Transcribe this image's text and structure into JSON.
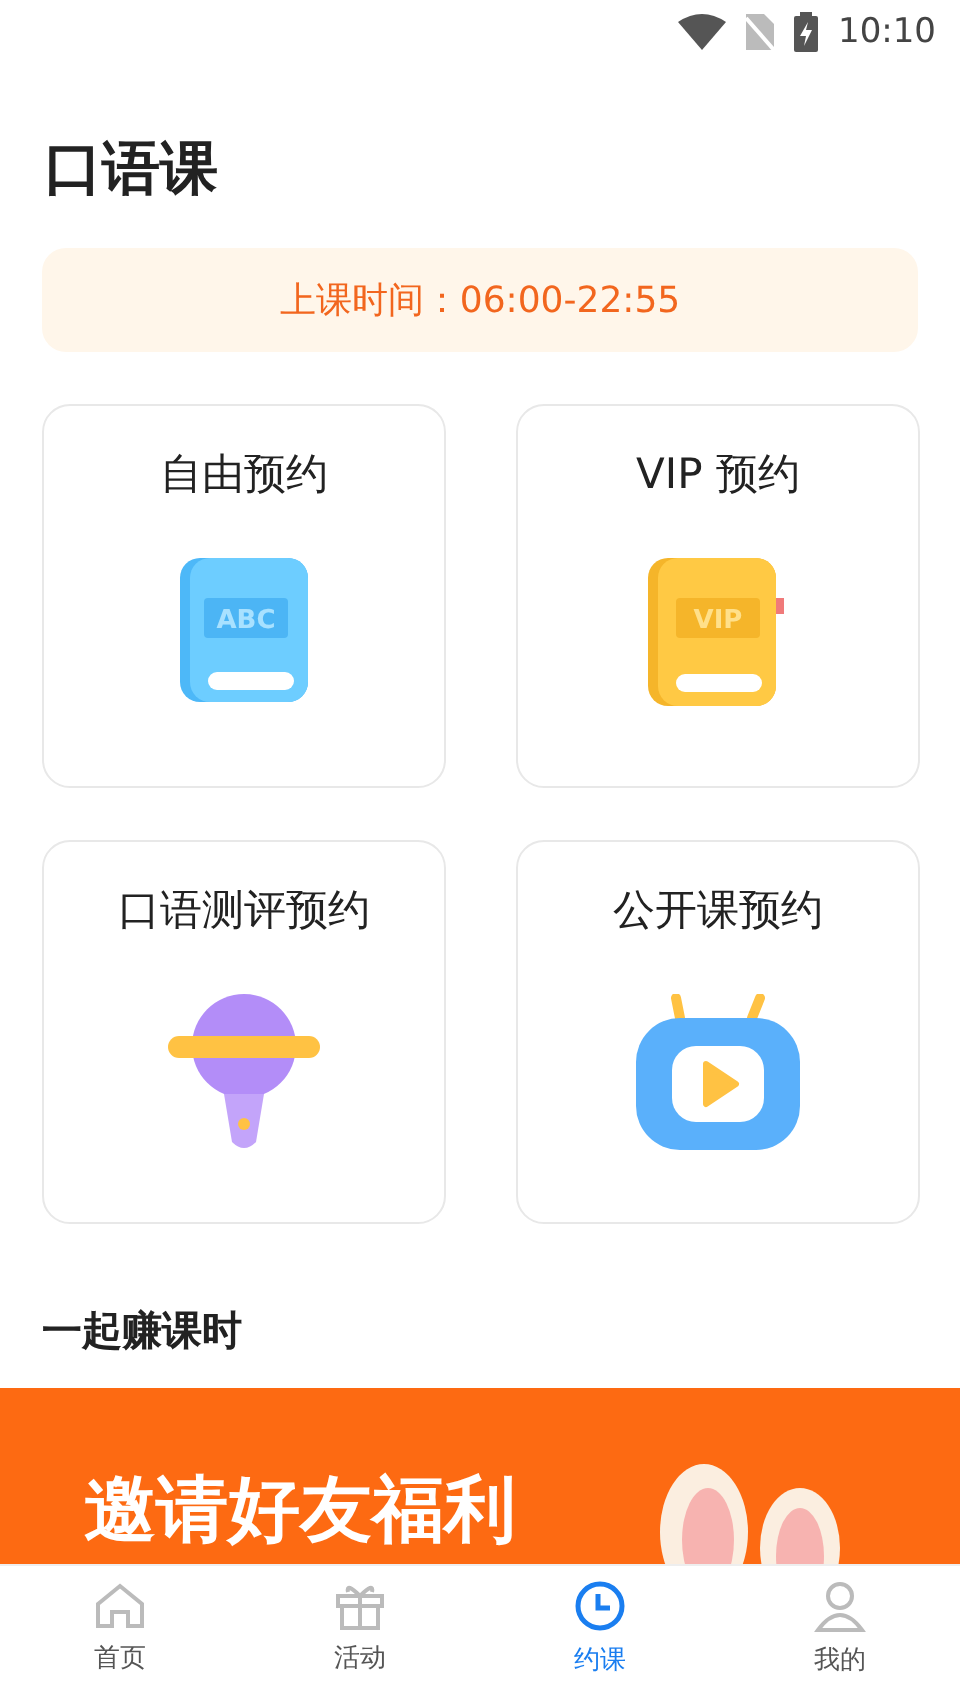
{
  "status_bar": {
    "time": "10:10"
  },
  "title": "口语课",
  "schedule": "上课时间：06:00-22:55",
  "booking_cards": [
    {
      "label": "自由预约",
      "icon_text": "ABC"
    },
    {
      "label": "VIP 预约",
      "icon_text": "VIP"
    },
    {
      "label": "口语测评预约"
    },
    {
      "label": "公开课预约"
    }
  ],
  "section_title": "一起赚课时",
  "banner": {
    "text": "邀请好友福利"
  },
  "bottom_nav": [
    {
      "label": "首页",
      "selected": false
    },
    {
      "label": "活动",
      "selected": false
    },
    {
      "label": "约课",
      "selected": true
    },
    {
      "label": "我的",
      "selected": false
    }
  ]
}
